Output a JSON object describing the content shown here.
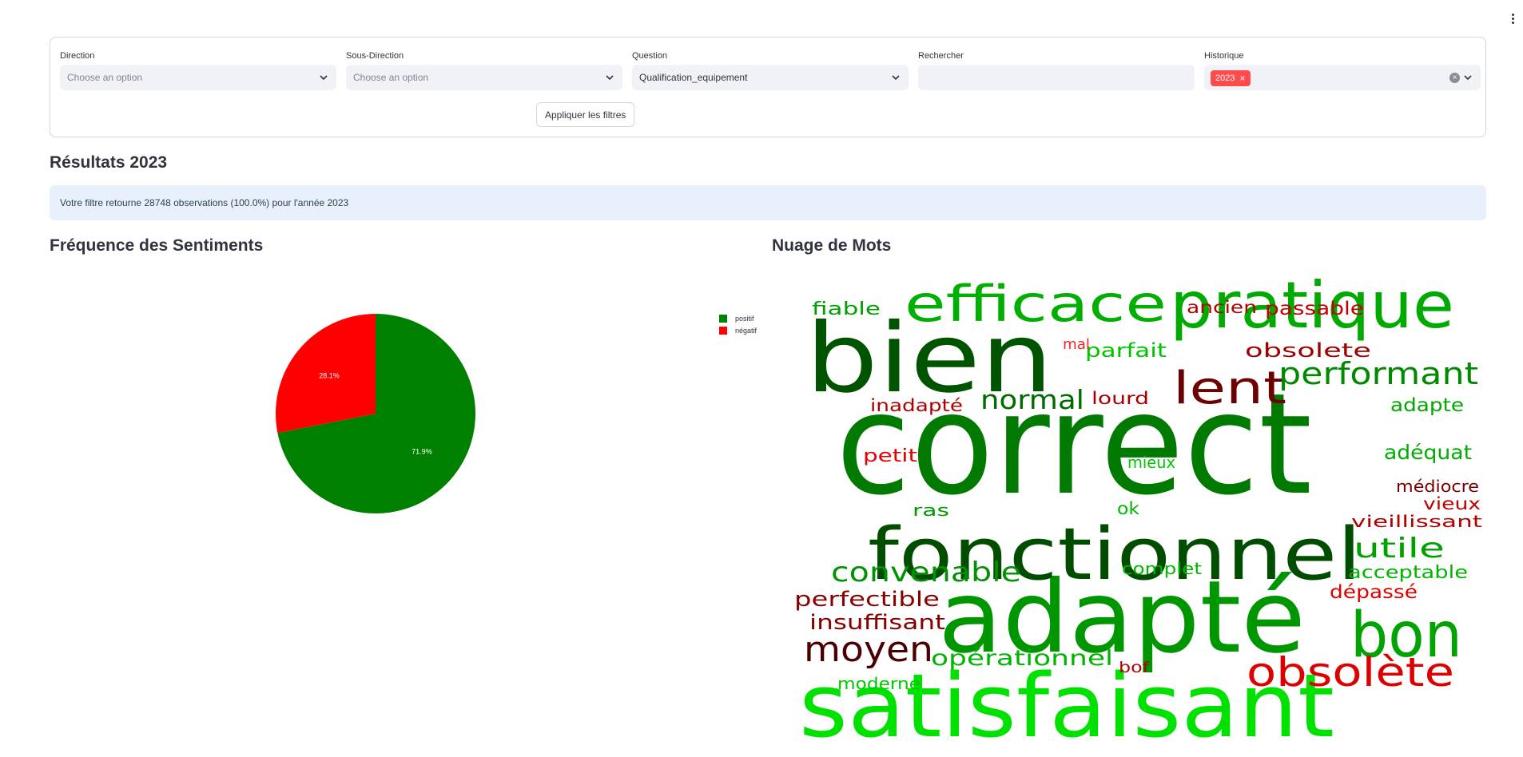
{
  "filters": {
    "direction": {
      "label": "Direction",
      "value": "Choose an option"
    },
    "sous_direction": {
      "label": "Sous-Direction",
      "value": "Choose an option"
    },
    "question": {
      "label": "Question",
      "value": "Qualification_equipement"
    },
    "rechercher": {
      "label": "Rechercher",
      "value": ""
    },
    "historique": {
      "label": "Historique",
      "chip": "2023",
      "chip_color": "#ff4b4b"
    },
    "apply_label": "Appliquer les filtres"
  },
  "results": {
    "title": "Résultats 2023",
    "info": "Votre filtre retourne 28748 observations (100.0%) pour l'année 2023"
  },
  "sentiment_chart_title": "Fréquence des Sentiments",
  "wordcloud_title": "Nuage de Mots",
  "chart_data": {
    "type": "pie",
    "categories": [
      "positif",
      "négatif"
    ],
    "values": [
      71.9,
      28.1
    ],
    "value_labels": [
      "71.9%",
      "28.1%"
    ],
    "colors": [
      "#008000",
      "#ff0000"
    ],
    "legend_position": "top-right"
  },
  "wordcloud": {
    "words": [
      {
        "text": "correct",
        "color": "#007a00"
      },
      {
        "text": "satisfaisant",
        "color": "#00e100"
      },
      {
        "text": "adapté",
        "color": "#009600"
      },
      {
        "text": "bien",
        "color": "#005400"
      },
      {
        "text": "fonctionnel",
        "color": "#004d00"
      },
      {
        "text": "pratique",
        "color": "#00aa00"
      },
      {
        "text": "efficace",
        "color": "#00b000"
      },
      {
        "text": "bon",
        "color": "#00a300"
      },
      {
        "text": "lent",
        "color": "#6d0000"
      },
      {
        "text": "obsolète",
        "color": "#dd0000"
      },
      {
        "text": "performant",
        "color": "#008a00"
      },
      {
        "text": "moyen",
        "color": "#4a0000"
      },
      {
        "text": "convenable",
        "color": "#009200"
      },
      {
        "text": "normal",
        "color": "#006b00"
      },
      {
        "text": "utile",
        "color": "#00a000"
      },
      {
        "text": "opérationnel",
        "color": "#00b300"
      },
      {
        "text": "perfectible",
        "color": "#8a0000"
      },
      {
        "text": "insuffisant",
        "color": "#850000"
      },
      {
        "text": "obsolete",
        "color": "#9e0000"
      },
      {
        "text": "parfait",
        "color": "#00c400"
      },
      {
        "text": "adapte",
        "color": "#00a800"
      },
      {
        "text": "adéquat",
        "color": "#00ac00"
      },
      {
        "text": "acceptable",
        "color": "#00b400"
      },
      {
        "text": "dépassé",
        "color": "#e10000"
      },
      {
        "text": "passable",
        "color": "#c40000"
      },
      {
        "text": "ancien",
        "color": "#b30000"
      },
      {
        "text": "fiable",
        "color": "#00a000"
      },
      {
        "text": "lourd",
        "color": "#a80000"
      },
      {
        "text": "inadapté",
        "color": "#b20000"
      },
      {
        "text": "petit",
        "color": "#e50000"
      },
      {
        "text": "mieux",
        "color": "#00c600"
      },
      {
        "text": "médiocre",
        "color": "#7a0000"
      },
      {
        "text": "vieux",
        "color": "#be0000"
      },
      {
        "text": "vieillissant",
        "color": "#b50000"
      },
      {
        "text": "complet",
        "color": "#00b800"
      },
      {
        "text": "ras",
        "color": "#009c00"
      },
      {
        "text": "ok",
        "color": "#00b700"
      },
      {
        "text": "moderne",
        "color": "#00c800"
      },
      {
        "text": "bof",
        "color": "#b00000"
      },
      {
        "text": "mal",
        "color": "#ff2020"
      }
    ]
  }
}
